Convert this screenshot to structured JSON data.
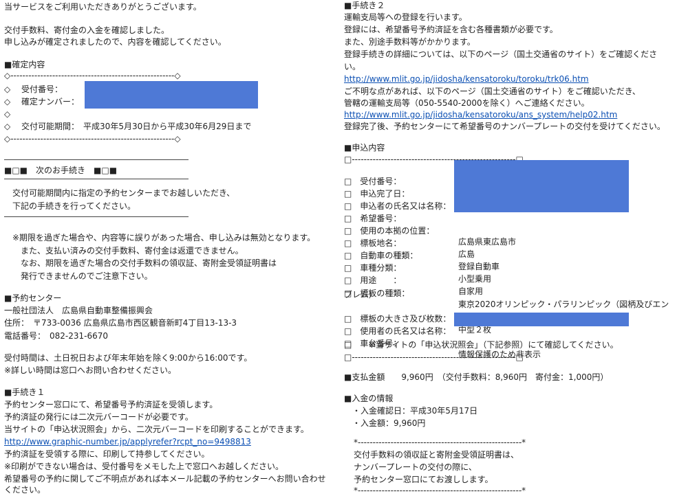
{
  "left": {
    "greeting": "当サービスをご利用いただきありがとうございます。",
    "confirm1": "交付手数料、寄付金の入金を確認しました。",
    "confirm2": "申し込みが確定されましたので、内容を確認してください。",
    "kakutei_heading": "■確定内容",
    "border_line": "◇-------------------------------------------------------◇",
    "receipt_label": "◇　 受付番号：",
    "plate_label": "◇　 確定ナンバー：",
    "diamond_empty": "◇",
    "period_line": "◇　 交付可能期間：　平成30年5月30日から平成30年6月29日まで",
    "next_heading": "■□■　次のお手続き　■□■",
    "next1": "　交付可能期間内に指定の予約センターまでお越しいただき、",
    "next2": "　下記の手続きを行ってください。",
    "note1": "　※期限を過ぎた場合や、内容等に誤りがあった場合、申し込みは無効となります。",
    "note2": "　　また、支払い済みの交付手数料、寄付金は返還できません。",
    "note3": "　　なお、期限を過ぎた場合の交付手数料の領収証、寄附金受領証明書は",
    "note4": "　　発行できませんのでご注意下さい。",
    "center_heading": "■予約センター",
    "center_name": "一般社団法人　広島県自動車整備振興会",
    "center_address": "住所：　〒733-0036 広島県広島市西区観音新町4丁目13-13-3",
    "center_phone": "電話番号：　082-231-6670",
    "hours1": "受付時間は、土日祝日および年末年始を除く9:00から16:00です。",
    "hours2": "※詳しい時間は窓口へお問い合わせください。",
    "step1_heading": "■手続き１",
    "step1_1": "予約センター窓口にて、希望番号予約済証を受領します。",
    "step1_2": "予約済証の発行には二次元バーコードが必要です。",
    "step1_3": "当サイトの「申込状況照会」から、二次元バーコードを印刷することができます。",
    "step1_link": "http://www.graphic-number.jp/applyrefer?rcpt_no=9498813",
    "step1_4": "予約済証を受領する際に、印刷して持参してください。",
    "step1_5": "※印刷ができない場合は、受付番号をメモした上で窓口へお越しください。",
    "step1_6": "希望番号の予約に関してご不明点があれば本メール記載の予約センターへお問い合わせ",
    "step1_7": "ください。"
  },
  "right": {
    "step2_heading": "■手続き２",
    "step2_1": "運輸支局等への登録を行います。",
    "step2_2": "登録には、希望番号予約済証を含む各種書類が必要です。",
    "step2_3": "また、別途手数料等がかかります。",
    "step2_4": "登録手続きの詳細については、以下のページ（国土交通省のサイト）をご確認くださ",
    "step2_5": "い。",
    "link1": "http://www.mlit.go.jp/jidosha/kensatoroku/toroku/trk06.htm",
    "step2_6": "ご不明な点があれば、以下のページ（国土交通省のサイト）をご確認いただき、",
    "step2_7": "管轄の運輸支局等（050-5540-2000を除く）へご連絡ください。",
    "link2": "http://www.mlit.go.jp/jidosha/kensatoroku/ans_system/help02.htm",
    "step2_8": "登録完了後、予約センターにて希望番号のナンバープレートの交付を受けてください。",
    "moushikomi_heading": "■申込内容",
    "sq_border": "□-------------------------------------------------------□",
    "rows": [
      {
        "k": "□　受付番号：",
        "v": ""
      },
      {
        "k": "□　申込完了日：",
        "v": ""
      },
      {
        "k": "□　申込者の氏名又は名称：",
        "v": ""
      },
      {
        "k": "□　希望番号：",
        "v": ""
      },
      {
        "k": "□　使用の本拠の位置：",
        "v": "広島県東広島市"
      },
      {
        "k": "□　標板地名：",
        "v": "広島"
      },
      {
        "k": "□　自動車の種類：",
        "v": "登録自動車"
      },
      {
        "k": "□　車種分類：",
        "v": "小型乗用"
      },
      {
        "k": "□　用途　　：",
        "v": "自家用"
      },
      {
        "k": "□　標板の種類：",
        "v": "東京2020オリンピック・パラリンピック（図柄及びエン"
      }
    ],
    "emblem_cont": "ブレム）",
    "rows2": [
      {
        "k": "□　標板の大きさ及び枚数：",
        "v": "中型２枚"
      },
      {
        "k": "□　使用者の氏名又は名称：",
        "v": ""
      },
      {
        "k": "□　車台番号：",
        "v": "情報保護のため非表示"
      }
    ],
    "check_note": "□　　※当サイトの「申込状況照会」（下記参照）にて確認してください。",
    "payment": "■支払金額　　9,960円　（交付手数料：8,960円　寄付金：1,000円）",
    "nyukin_heading": "■入金の情報",
    "nyukin_date": "　・入金確認日：平成30年5月17日",
    "nyukin_amount": "　・入金額：9,960円",
    "star_border": "*-------------------------------------------------------*",
    "receipt1": "交付手数料の領収証と寄附金受領証明書は、",
    "receipt2": "ナンバープレートの交付の際に、",
    "receipt3": "予約センター窓口にてお渡しします。"
  },
  "colors": {
    "redaction": "#4e79d6",
    "link": "#0b4fb3"
  }
}
